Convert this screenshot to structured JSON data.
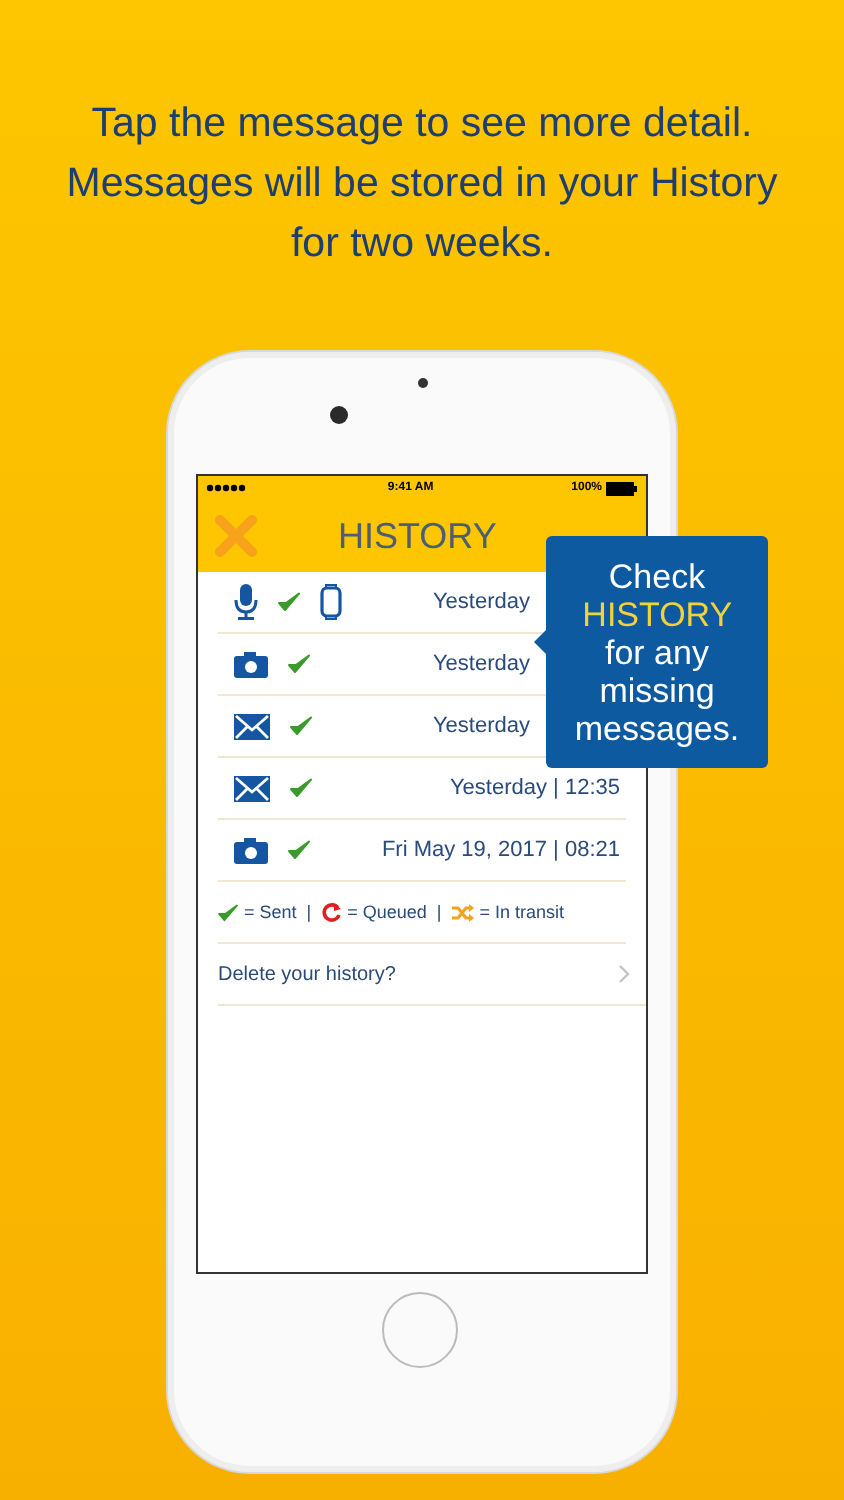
{
  "headline": "Tap the message to see more detail.\nMessages will be stored in your History\nfor two weeks.",
  "status_bar": {
    "time": "9:41 AM",
    "battery": "100%"
  },
  "header": {
    "title": "HISTORY"
  },
  "rows": [
    {
      "kind": "voice",
      "via_watch": true,
      "sent": true,
      "time": "Yesterday"
    },
    {
      "kind": "photo",
      "via_watch": false,
      "sent": true,
      "time": "Yesterday"
    },
    {
      "kind": "mail",
      "via_watch": false,
      "sent": true,
      "time": "Yesterday"
    },
    {
      "kind": "mail",
      "via_watch": false,
      "sent": true,
      "time": "Yesterday | 12:35"
    },
    {
      "kind": "photo",
      "via_watch": false,
      "sent": true,
      "time": "Fri May 19, 2017 | 08:21"
    }
  ],
  "legend": [
    {
      "kind": "sent",
      "label": "= Sent"
    },
    {
      "kind": "queued",
      "label": "= Queued"
    },
    {
      "kind": "transit",
      "label": "= In transit"
    }
  ],
  "legend_separator": "|",
  "delete_row": {
    "label": "Delete your history?"
  },
  "callout": {
    "text": "Check **HISTORY** for any missing messages."
  }
}
